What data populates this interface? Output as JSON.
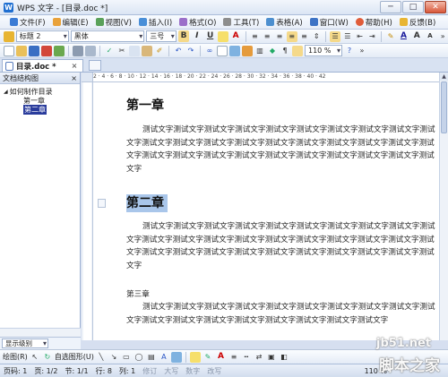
{
  "window": {
    "title": "WPS 文字 - [目录.doc *]",
    "app_icon": "W",
    "min": "─",
    "max": "□",
    "close": "✕"
  },
  "menu": [
    "文件(F)",
    "编辑(E)",
    "视图(V)",
    "插入(I)",
    "格式(O)",
    "工具(T)",
    "表格(A)",
    "窗口(W)",
    "帮助(H)",
    "反馈(B)"
  ],
  "format_toolbar": {
    "style": "标题 2",
    "font": "黑体",
    "size": "三号",
    "bold": "B",
    "italic": "I",
    "underline": "U",
    "font_color": "A"
  },
  "standard_toolbar": {
    "zoom": "110 %"
  },
  "tabs": {
    "active": "目录.doc *",
    "close": "×"
  },
  "nav_pane": {
    "title": "文档结构图",
    "close": "×",
    "root": "如何制作目录",
    "children": [
      "第一章",
      "第二章"
    ],
    "footer_select": "显示级别"
  },
  "ruler": {
    "marks": "2 · 4 · 6 · 8 · 10 · 12 · 14 · 16 · 18 · 20 · 22 · 24 · 26 · 28 · 30 · 32 · 34 · 36 · 38 · 40 · 42"
  },
  "document": {
    "heading1": "第一章",
    "para1": "测试文字测试文字测试文字测试文字测试文字测试文字测试文字测试文字测试文字测试文字测试文字测试文字测试文字测试文字测试文字测试文字测试文字测试文字测试文字测试文字测试文字测试文字测试文字测试文字测试文字测试文字测试文字测试文字测试文字测试文字",
    "heading2": "第二章",
    "para2": "测试文字测试文字测试文字测试文字测试文字测试文字测试文字测试文字测试文字测试文字测试文字测试文字测试文字测试文字测试文字测试文字测试文字测试文字测试文字测试文字测试文字测试文字测试文字测试文字测试文字测试文字测试文字测试文字测试文字测试文字",
    "heading3": "第三章",
    "para3": "测试文字测试文字测试文字测试文字测试文字测试文字测试文字测试文字测试文字测试文字测试文字测试文字测试文字测试文字测试文字测试文字测试文字测试文字"
  },
  "drawing_toolbar": {
    "draw": "绘图(R)",
    "autoshapes": "自选图形(U)"
  },
  "status": {
    "page": "页码: 1",
    "pages": "页: 1/2",
    "section": "节: 1/1",
    "line": "行: 8",
    "column": "列: 1",
    "rev": "修订",
    "caps": "大写",
    "num": "数字",
    "ovr": "改写",
    "zoom": "110 %"
  },
  "watermark": {
    "line1": "jb51.net",
    "line2": "脚本之家"
  },
  "colors": {
    "accent": "#2a3c9c",
    "selection": "#a9c6ea",
    "chrome": "#d6dff0"
  }
}
